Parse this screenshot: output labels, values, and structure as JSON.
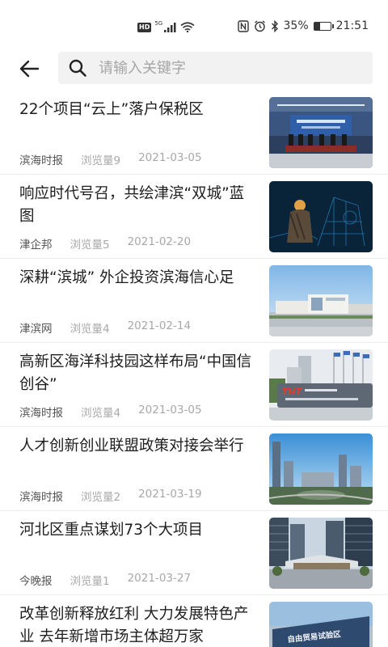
{
  "status_bar": {
    "hd": "HD",
    "signal_label": "5G",
    "battery_percent": "35%",
    "time": "21:51",
    "battery_level": 0.35
  },
  "search": {
    "placeholder": "请输入关键字",
    "value": ""
  },
  "news": [
    {
      "title": "22个项目“云上”落户保税区",
      "source": "滨海时报",
      "views": "浏览量9",
      "date": "2021-03-05",
      "thumb_icon": "signing-ceremony-photo"
    },
    {
      "title": "响应时代号召，共绘津滨“双城”蓝图",
      "source": "津企邦",
      "views": "浏览量5",
      "date": "2021-02-20",
      "thumb_icon": "engineer-blueprint-photo"
    },
    {
      "title": "深耕“滨城” 外企投资滨海信心足",
      "source": "津滨网",
      "views": "浏览量4",
      "date": "2021-02-14",
      "thumb_icon": "factory-building-photo"
    },
    {
      "title": "高新区海洋科技园这样布局“中国信创谷”",
      "source": "滨海时报",
      "views": "浏览量4",
      "date": "2021-03-05",
      "thumb_icon": "tech-park-sign-photo"
    },
    {
      "title": "人才创新创业联盟政策对接会举行",
      "source": "滨海时报",
      "views": "浏览量2",
      "date": "2021-03-19",
      "thumb_icon": "city-aerial-photo"
    },
    {
      "title": "河北区重点谋划73个大项目",
      "source": "今晚报",
      "views": "浏览量1",
      "date": "2021-03-27",
      "thumb_icon": "modern-plaza-photo"
    },
    {
      "title": "改革创新释放红利 大力发展特色产业 去年新增市场主体超万家",
      "source": "",
      "views": "",
      "date": "",
      "thumb_icon": "free-trade-zone-photo"
    }
  ],
  "thumb_texts": {
    "thumb_4": "THT",
    "thumb_7": "自由贸易试验区"
  }
}
